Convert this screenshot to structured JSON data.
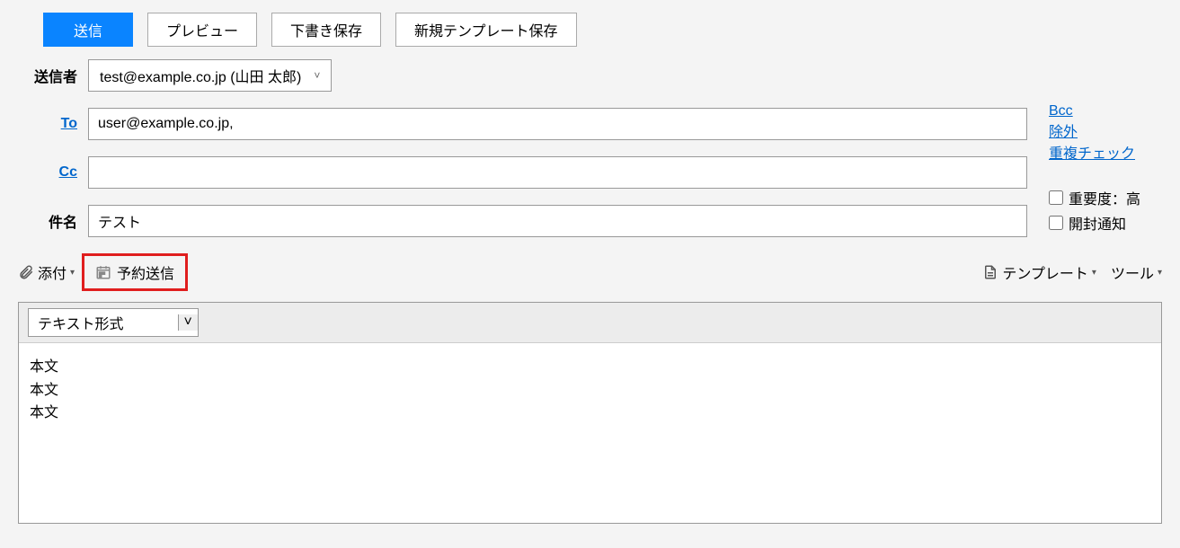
{
  "toolbar": {
    "send": "送信",
    "preview": "プレビュー",
    "draft_save": "下書き保存",
    "save_template": "新規テンプレート保存"
  },
  "form": {
    "sender_label": "送信者",
    "sender_value": "test@example.co.jp (山田 太郎)",
    "to_label": "To",
    "to_value": "user@example.co.jp,",
    "cc_label": "Cc",
    "cc_value": "",
    "subject_label": "件名",
    "subject_value": "テスト"
  },
  "side": {
    "bcc": "Bcc",
    "exclude": "除外",
    "dup_check": "重複チェック",
    "priority_label": "重要度：高",
    "read_receipt_label": "開封通知"
  },
  "actions": {
    "attach": "添付",
    "schedule_send": "予約送信",
    "template": "テンプレート",
    "tools": "ツール"
  },
  "editor": {
    "format": "テキスト形式",
    "body": "本文\n本文\n本文"
  }
}
